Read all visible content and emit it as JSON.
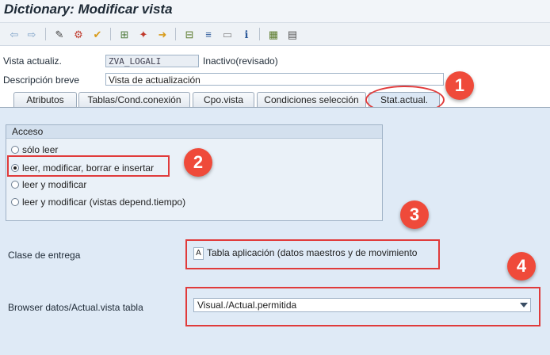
{
  "window": {
    "title": "Dictionary: Modificar vista"
  },
  "header": {
    "vista_label": "Vista actualiz.",
    "vista_value": "ZVA_LOGALI",
    "vista_status": "Inactivo(revisado)",
    "desc_label": "Descripción breve",
    "desc_value": "Vista de actualización"
  },
  "tabs": [
    {
      "label": "Atributos"
    },
    {
      "label": "Tablas/Cond.conexión"
    },
    {
      "label": "Cpo.vista"
    },
    {
      "label": "Condiciones selección"
    },
    {
      "label": "Stat.actual."
    }
  ],
  "acceso": {
    "title": "Acceso",
    "options": [
      {
        "label": "sólo leer",
        "selected": false
      },
      {
        "label": "leer, modificar, borrar e insertar",
        "selected": true
      },
      {
        "label": "leer y modificar",
        "selected": false
      },
      {
        "label": "leer y modificar (vistas depend.tiempo)",
        "selected": false
      }
    ]
  },
  "clase_entrega": {
    "label": "Clase de entrega",
    "code": "A",
    "value": "Tabla aplicación (datos maestros y de movimiento"
  },
  "browser": {
    "label": "Browser datos/Actual.vista tabla",
    "selected": "Visual./Actual.permitida"
  },
  "annotations": [
    "1",
    "2",
    "3",
    "4"
  ],
  "colors": {
    "annotation": "#ef4a3a",
    "content_bg": "#dfeaf6"
  }
}
